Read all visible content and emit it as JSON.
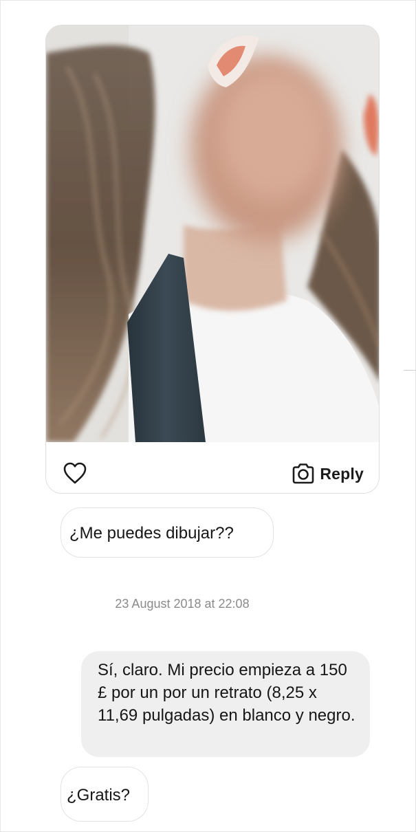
{
  "story_reply": {
    "image_alt": "Shared story photo with blurred face",
    "reply_label": "Reply",
    "like_icon": "heart-outline-icon",
    "reply_icon": "camera-outline-icon"
  },
  "messages": [
    {
      "side": "received",
      "text": "¿Me puedes dibujar??"
    },
    {
      "side": "sent",
      "text": "Sí, claro. Mi precio empieza a 150 £ por un por un retrato (8,25 x 11,69 pulgadas) en blanco y negro."
    },
    {
      "side": "received",
      "text": "¿Gratis?"
    }
  ],
  "timestamp": "23 August 2018 at 22:08",
  "colors": {
    "sent_bubble": "#efefef",
    "received_border": "#e2e2e2",
    "timestamp_text": "#8a8a8a",
    "icon": "#1b1b1b"
  }
}
